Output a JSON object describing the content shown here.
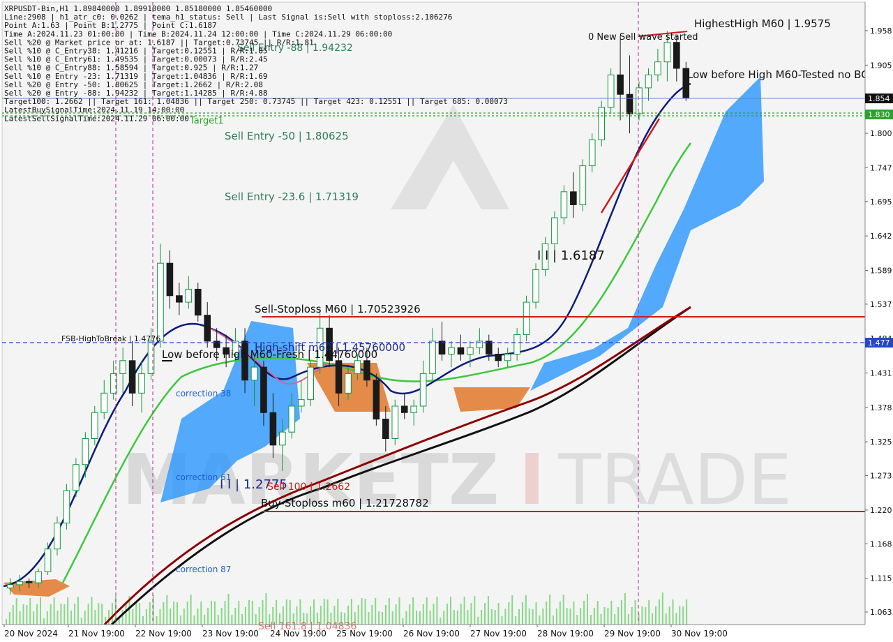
{
  "symbol_line": "XRPUSDT-Bin,H1  1.89840000 1.89910000 1.85180000 1.85460000",
  "info_lines": [
    "Line:2908 | h1_atr_c0: 0.0262 | tema_h1_status: Sell | Last Signal is:Sell with stoploss:2.106276",
    "Point A:1.63 | Point B:1.2775 | Point C:1.6187",
    "Time A:2024.11.23 01:00:00 | Time B:2024.11.24 12:00:00 | Time C:2024.11.29 06:00:00",
    "Sell %20 @ Market price or at: 1.6187 || Target:0.73745 || R/R:1.81",
    "Sell %10 @ C_Entry38: 1.41216 | Target:0.12551 | R/R:1.85",
    "Sell %10 @ C_Entry61: 1.49535 | Target:0.00073 | R/R:2.45",
    "Sell %10 @ C_Entry88: 1.58594 | Target:0.925 | R/R:1.27",
    "Sell %10 @ Entry -23: 1.71319 | Target:1.04836 | R/R:1.69",
    "Sell %20 @ Entry -50: 1.80625 | Target:1.2662 | R/R:2.08",
    "Sell %20 @ Entry -88: 1.94232 | Target:1.14285 | R/R:4.88",
    "Target100: 1.2662 || Target 161: 1.04836 || Target 250: 0.73745 || Target 423: 0.12551 || Target 685: 0.00073",
    "LatestBuySignalTime:2024.11.19 14:00:00",
    "LatestSellSignalTime:2024.11.29 06:00:00"
  ],
  "price_labels": [
    "1.958",
    "1.905",
    "1.853",
    "1.800",
    "1.747",
    "1.695",
    "1.642",
    "1.589",
    "1.537",
    "1.484",
    "1.431",
    "1.378",
    "1.325",
    "1.273",
    "1.220",
    "1.168",
    "1.115",
    "1.063"
  ],
  "time_labels": [
    "20 Nov 2024",
    "21 Nov 19:00",
    "22 Nov 19:00",
    "23 Nov 19:00",
    "24 Nov 19:00",
    "25 Nov 19:00",
    "26 Nov 19:00",
    "27 Nov 19:00",
    "28 Nov 19:00",
    "29 Nov 19:00",
    "30 Nov 19:00"
  ],
  "price_tags": {
    "current": "1.854",
    "green": "1.830",
    "blue": "1.477"
  },
  "annotations": {
    "highest_high": "HighestHigh   M60 | 1.9575",
    "low_before_high_right": "Low before High   M60-Tested no BOS",
    "new_sell_wave": "0 New Sell wave started",
    "sell_entry_88": "Sell Entry -88 | 1.94232",
    "sell_entry_50": "Sell Entry -50 | 1.80625",
    "sell_entry_23": "Sell Entry -23.6 | 1.71319",
    "target1": "Target1",
    "point_c": "I I | 1.6187",
    "sell_stoploss": "Sell-Stoploss M60 | 1.70523926",
    "fsb": "FSB-HighToBreak | 1.4776",
    "high_shift": "High-shift m60 | 1.45760000",
    "low_before_high_left": "Low before High   M60-Fresh | 1.44760000",
    "correction38": "correction 38",
    "correction61": "correction 61",
    "correction87": "correction 87",
    "point_b": "I I | 1.2775",
    "sell100": "Sell 100 | 1.2662",
    "buy_stoploss": "Buy-Stoploss m60 | 1.21728782",
    "sell_bottom": "Sell 161.8 | 1.04836"
  },
  "watermark": {
    "left": "MARKETZ",
    "mid": "I",
    "right": "TRADE"
  },
  "colors": {
    "up": "#0a9a3a",
    "down": "#1a1a1a",
    "red_line": "#d11a1a",
    "blue_dash": "#2646c8",
    "cloud_blue": "#1e90ff",
    "cloud_orange": "#e0701e",
    "tema_navy": "#0c1c7a",
    "ma_green": "#3cc83c"
  },
  "chart_data": {
    "type": "candlestick",
    "symbol": "XRPUSDT-Bin",
    "timeframe": "H1",
    "ylim": [
      1.04,
      1.98
    ],
    "series": [
      {
        "name": "XRPUSDT",
        "ohlc": [
          [
            1.1,
            1.115,
            1.09,
            1.105
          ],
          [
            1.105,
            1.12,
            1.095,
            1.11
          ],
          [
            1.11,
            1.115,
            1.1,
            1.108
          ],
          [
            1.108,
            1.13,
            1.1,
            1.125
          ],
          [
            1.125,
            1.17,
            1.12,
            1.16
          ],
          [
            1.16,
            1.21,
            1.15,
            1.2
          ],
          [
            1.2,
            1.26,
            1.19,
            1.25
          ],
          [
            1.25,
            1.3,
            1.24,
            1.29
          ],
          [
            1.29,
            1.34,
            1.27,
            1.33
          ],
          [
            1.33,
            1.38,
            1.32,
            1.37
          ],
          [
            1.37,
            1.42,
            1.36,
            1.4
          ],
          [
            1.4,
            1.45,
            1.39,
            1.43
          ],
          [
            1.43,
            1.47,
            1.4,
            1.45
          ],
          [
            1.45,
            1.48,
            1.38,
            1.4
          ],
          [
            1.4,
            1.45,
            1.37,
            1.43
          ],
          [
            1.43,
            1.5,
            1.42,
            1.48
          ],
          [
            1.48,
            1.63,
            1.47,
            1.6
          ],
          [
            1.6,
            1.62,
            1.53,
            1.55
          ],
          [
            1.55,
            1.57,
            1.52,
            1.54
          ],
          [
            1.54,
            1.58,
            1.53,
            1.56
          ],
          [
            1.56,
            1.57,
            1.51,
            1.52
          ],
          [
            1.52,
            1.54,
            1.47,
            1.48
          ],
          [
            1.48,
            1.5,
            1.45,
            1.47
          ],
          [
            1.47,
            1.49,
            1.44,
            1.46
          ],
          [
            1.46,
            1.5,
            1.45,
            1.48
          ],
          [
            1.48,
            1.5,
            1.4,
            1.42
          ],
          [
            1.42,
            1.46,
            1.38,
            1.44
          ],
          [
            1.44,
            1.45,
            1.35,
            1.37
          ],
          [
            1.37,
            1.4,
            1.3,
            1.32
          ],
          [
            1.32,
            1.36,
            1.28,
            1.34
          ],
          [
            1.34,
            1.4,
            1.33,
            1.38
          ],
          [
            1.38,
            1.42,
            1.37,
            1.39
          ],
          [
            1.39,
            1.45,
            1.38,
            1.44
          ],
          [
            1.44,
            1.53,
            1.43,
            1.5
          ],
          [
            1.5,
            1.52,
            1.44,
            1.45
          ],
          [
            1.45,
            1.47,
            1.38,
            1.4
          ],
          [
            1.4,
            1.44,
            1.39,
            1.43
          ],
          [
            1.43,
            1.46,
            1.42,
            1.45
          ],
          [
            1.45,
            1.47,
            1.41,
            1.42
          ],
          [
            1.42,
            1.43,
            1.35,
            1.36
          ],
          [
            1.36,
            1.38,
            1.31,
            1.33
          ],
          [
            1.33,
            1.39,
            1.32,
            1.38
          ],
          [
            1.38,
            1.4,
            1.36,
            1.37
          ],
          [
            1.37,
            1.39,
            1.35,
            1.38
          ],
          [
            1.38,
            1.45,
            1.37,
            1.43
          ],
          [
            1.43,
            1.5,
            1.42,
            1.48
          ],
          [
            1.48,
            1.51,
            1.45,
            1.46
          ],
          [
            1.46,
            1.48,
            1.44,
            1.47
          ],
          [
            1.47,
            1.49,
            1.45,
            1.46
          ],
          [
            1.46,
            1.48,
            1.44,
            1.47
          ],
          [
            1.47,
            1.5,
            1.46,
            1.48
          ],
          [
            1.48,
            1.49,
            1.45,
            1.46
          ],
          [
            1.46,
            1.47,
            1.44,
            1.45
          ],
          [
            1.45,
            1.47,
            1.44,
            1.46
          ],
          [
            1.46,
            1.5,
            1.45,
            1.49
          ],
          [
            1.49,
            1.55,
            1.48,
            1.54
          ],
          [
            1.54,
            1.6,
            1.53,
            1.59
          ],
          [
            1.59,
            1.64,
            1.58,
            1.63
          ],
          [
            1.63,
            1.68,
            1.62,
            1.67
          ],
          [
            1.67,
            1.72,
            1.66,
            1.71
          ],
          [
            1.71,
            1.74,
            1.67,
            1.69
          ],
          [
            1.69,
            1.76,
            1.68,
            1.75
          ],
          [
            1.75,
            1.8,
            1.74,
            1.79
          ],
          [
            1.79,
            1.85,
            1.78,
            1.84
          ],
          [
            1.84,
            1.9,
            1.83,
            1.89
          ],
          [
            1.89,
            1.95,
            1.82,
            1.86
          ],
          [
            1.86,
            1.92,
            1.8,
            1.83
          ],
          [
            1.83,
            1.88,
            1.82,
            1.87
          ],
          [
            1.87,
            1.9,
            1.85,
            1.89
          ],
          [
            1.89,
            1.93,
            1.88,
            1.91
          ],
          [
            1.91,
            1.9575,
            1.88,
            1.94
          ],
          [
            1.94,
            1.95,
            1.88,
            1.9
          ],
          [
            1.9,
            1.91,
            1.85,
            1.855
          ]
        ]
      }
    ],
    "levels": [
      {
        "label": "Sell-Stoploss M60",
        "value": 1.70523926
      },
      {
        "label": "Buy-Stoploss m60",
        "value": 1.21728782
      },
      {
        "label": "FSB-HighToBreak",
        "value": 1.4776
      },
      {
        "label": "Current price",
        "value": 1.854
      },
      {
        "label": "Target line",
        "value": 1.83
      }
    ]
  }
}
